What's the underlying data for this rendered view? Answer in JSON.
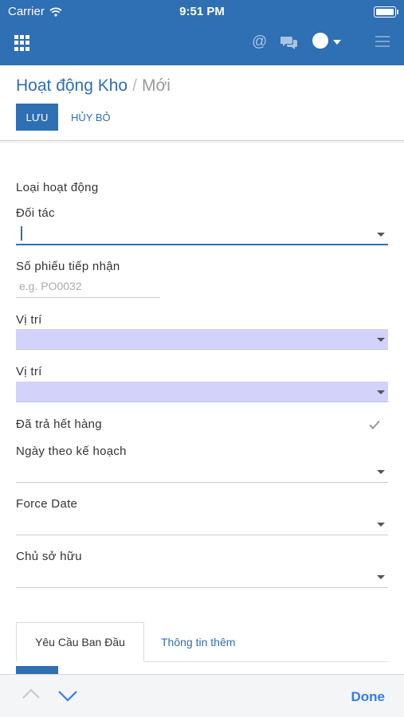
{
  "status_bar": {
    "carrier": "Carrier",
    "time": "9:51 PM",
    "battery_level": 1.0
  },
  "nav": {
    "at_symbol": "@",
    "icons": [
      "apps-grid-icon",
      "at-icon",
      "chat-icon",
      "avatar",
      "chevron-down-icon",
      "hamburger-menu-icon"
    ]
  },
  "breadcrumb": {
    "parent": "Hoạt động Kho",
    "separator": "/",
    "current": "Mới"
  },
  "actions": {
    "save": "LƯU",
    "cancel": "HỦY BỎ"
  },
  "form": {
    "operation_type": {
      "label": "Loại hoạt động"
    },
    "partner": {
      "label": "Đối tác",
      "value": ""
    },
    "receipt_no": {
      "label": "Số phiếu tiếp nhận",
      "placeholder": "e.g. PO0032"
    },
    "location_src": {
      "label": "Vị trí",
      "value": ""
    },
    "location_dest": {
      "label": "Vị trí",
      "value": ""
    },
    "returned": {
      "label": "Đã trả hết hàng",
      "checked": true
    },
    "scheduled_date": {
      "label": "Ngày theo kế hoạch",
      "value": ""
    },
    "force_date": {
      "label": "Force Date",
      "value": ""
    },
    "owner": {
      "label": "Chủ sở hữu",
      "value": ""
    }
  },
  "tabs": {
    "active": "Yêu Cầu Ban Đầu",
    "other": "Thông tin thêm"
  },
  "keyboard_toolbar": {
    "done": "Done"
  },
  "colors": {
    "primary": "#2f6fb3",
    "required_bg": "#d2d2fb",
    "ios_blue": "#2f7cf6"
  }
}
